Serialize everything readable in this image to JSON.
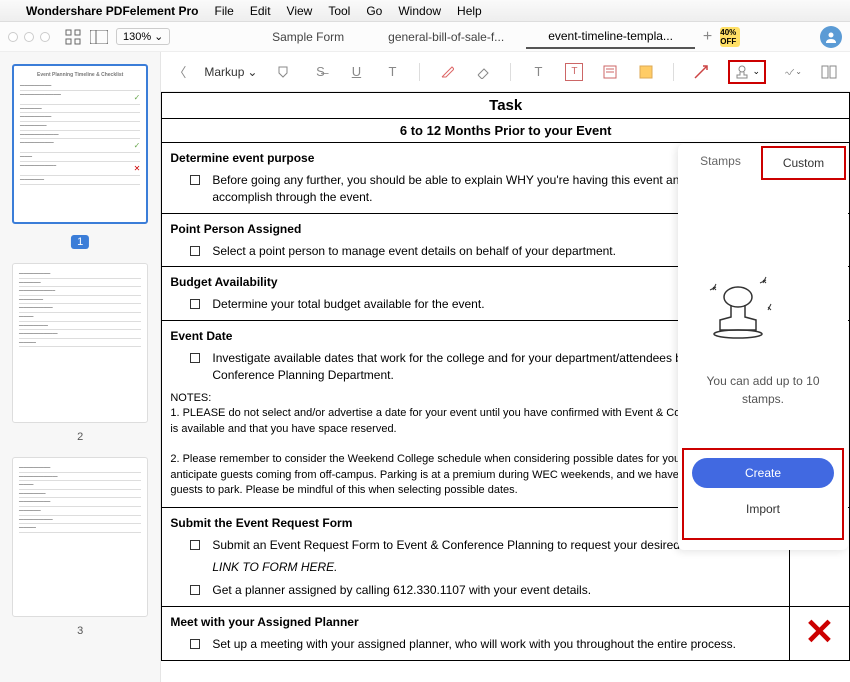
{
  "menubar": {
    "app_name": "Wondershare PDFelement Pro",
    "items": [
      "File",
      "Edit",
      "View",
      "Tool",
      "Go",
      "Window",
      "Help"
    ]
  },
  "titlebar": {
    "zoom": "130%",
    "promo": "40% OFF"
  },
  "tabs": {
    "items": [
      {
        "label": "Sample Form"
      },
      {
        "label": "general-bill-of-sale-f..."
      },
      {
        "label": "event-timeline-templa..."
      }
    ],
    "active": 2
  },
  "toolbar": {
    "markup_label": "Markup"
  },
  "thumbnails": {
    "pages": [
      "1",
      "2",
      "3"
    ],
    "thumb_title": "Event Planning Timeline & Checklist"
  },
  "document": {
    "task_header": "Task",
    "timeframe_header": "6 to 12 Months Prior to your Event",
    "sections": [
      {
        "title": "Determine event purpose",
        "items": [
          "Before going any further, you should be able to explain WHY you're having this event and what you hope to accomplish through the event."
        ]
      },
      {
        "title": "Point Person Assigned",
        "items": [
          "Select a point person to manage event details on behalf of your department."
        ]
      },
      {
        "title": "Budget Availability",
        "items": [
          "Determine your total budget available for the event."
        ]
      },
      {
        "title": "Event Date",
        "items": [
          "Investigate available dates that work for the college and for your department/attendees by contacting the Event & Conference Planning Department."
        ],
        "notes": "NOTES:\n1.  PLEASE do not select and/or advertise a date for your event until you have confirmed with Event & Conference Planning that the date is available and that you have space reserved.\n\n2.  Please remember to consider the Weekend College schedule when considering possible dates for your event, especially if you anticipate guests coming from off-campus.  Parking is at a premium during WEC weekends, and we have little availability for additional guests to park.  Please be mindful of this when selecting possible dates."
      },
      {
        "title": "Submit the Event Request Form",
        "items": [
          "Submit an Event Request Form to Event & Conference Planning to request your desired date.",
          "LINK TO FORM HERE.",
          "Get a planner assigned by calling 612.330.1107 with your event details."
        ],
        "status": "check"
      },
      {
        "title": "Meet with your Assigned Planner",
        "items": [
          "Set up a meeting with your assigned planner, who will work with you throughout the entire process."
        ],
        "status": "x"
      }
    ]
  },
  "panel": {
    "tab_stamps": "Stamps",
    "tab_custom": "Custom",
    "message": "You can add up to 10 stamps.",
    "create_btn": "Create",
    "import_btn": "Import"
  }
}
